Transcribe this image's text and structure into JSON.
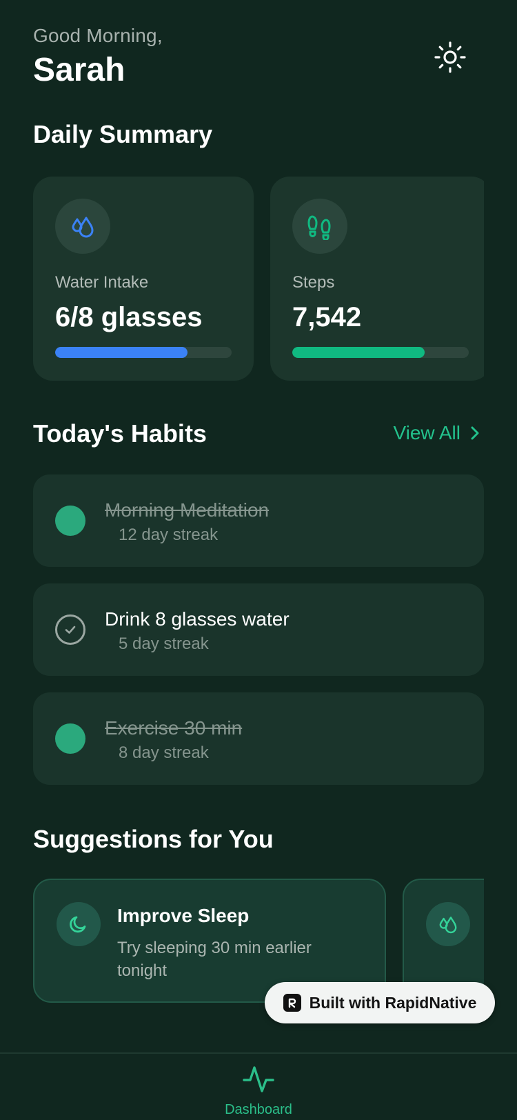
{
  "header": {
    "greeting": "Good Morning,",
    "username": "Sarah",
    "theme_icon": "sun-icon"
  },
  "daily_summary": {
    "title": "Daily Summary",
    "cards": [
      {
        "icon": "water-drops-icon",
        "label": "Water Intake",
        "value": "6/8 glasses",
        "progress": 0.75,
        "color": "#3b82f6"
      },
      {
        "icon": "footsteps-icon",
        "label": "Steps",
        "value": "7,542",
        "progress": 0.75,
        "color": "#10b981"
      }
    ]
  },
  "habits": {
    "title": "Today's Habits",
    "view_all_label": "View All",
    "items": [
      {
        "name": "Morning Meditation",
        "streak": "12 day streak",
        "completed": true
      },
      {
        "name": "Drink 8 glasses water",
        "streak": "5 day streak",
        "completed": false
      },
      {
        "name": "Exercise 30 min",
        "streak": "8 day streak",
        "completed": true
      }
    ]
  },
  "suggestions": {
    "title": "Suggestions for You",
    "items": [
      {
        "icon": "moon-icon",
        "title": "Improve Sleep",
        "description": "Try sleeping 30 min earlier tonight"
      },
      {
        "icon": "water-drops-icon",
        "title": "",
        "description": ""
      }
    ]
  },
  "badge": {
    "label": "Built with RapidNative"
  },
  "tab_bar": {
    "active_tab": "Dashboard",
    "tabs": [
      {
        "label": "Dashboard",
        "icon": "activity-pulse-icon"
      }
    ]
  },
  "colors": {
    "background": "#10271f",
    "card": "#1c362c",
    "accent": "#23c28d",
    "water": "#3b82f6",
    "steps": "#10b981"
  }
}
